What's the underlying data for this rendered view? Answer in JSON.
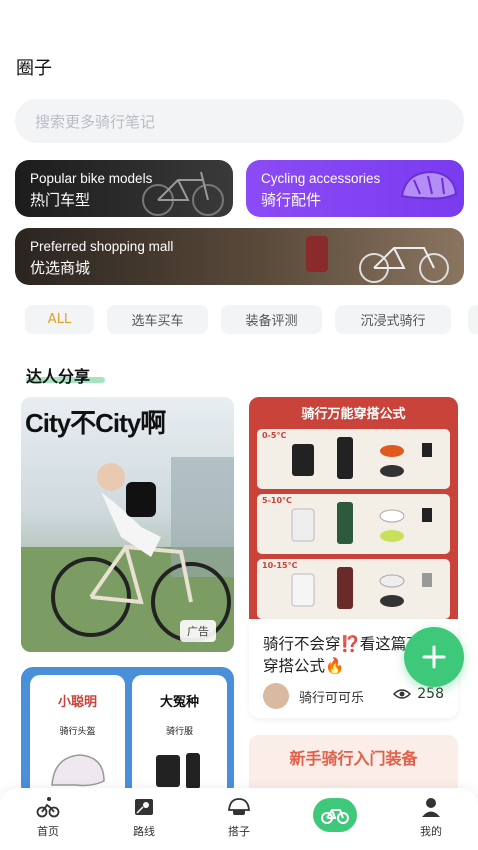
{
  "header": {
    "title": "圈子"
  },
  "search": {
    "placeholder": "搜索更多骑行笔记"
  },
  "categories": [
    {
      "en": "Popular bike models",
      "zh": "热门车型"
    },
    {
      "en": "Cycling accessories",
      "zh": "骑行配件"
    },
    {
      "en": "Preferred shopping mall",
      "zh": "优选商城"
    }
  ],
  "tabs": [
    "ALL",
    "选车买车",
    "装备评测",
    "沉浸式骑行"
  ],
  "section": {
    "title": "达人分享"
  },
  "ad_card": {
    "headline": "City不City啊",
    "badge": "广告"
  },
  "outfit_card": {
    "banner_title": "骑行万能穿搭公式",
    "ranges": [
      "0-5°C",
      "5-10°C",
      "10-15°C"
    ],
    "post_title": "骑行不会穿⁉️看这篇万能穿搭公式🔥",
    "author": "骑行可可乐",
    "views": "258"
  },
  "gear_card": {
    "items": [
      {
        "name": "小聪明",
        "sub": "骑行头盔"
      },
      {
        "name": "大冤种",
        "sub": "骑行服"
      }
    ]
  },
  "newbie_card": {
    "title": "新手骑行入门装备"
  },
  "bottom_nav": {
    "items": [
      {
        "label": "首页",
        "icon": "bike-rider-icon"
      },
      {
        "label": "路线",
        "icon": "map-pin-icon"
      },
      {
        "label": "搭子",
        "icon": "helmet-icon"
      },
      {
        "label": "",
        "icon": "bicycle-icon"
      },
      {
        "label": "我的",
        "icon": "profile-icon"
      }
    ]
  },
  "colors": {
    "accent_green": "#3ec97a",
    "accent_purple": "#8b4bf5",
    "tab_active": "#e0a020",
    "outfit_red": "#c9433a",
    "gear_blue": "#4a90d9"
  }
}
